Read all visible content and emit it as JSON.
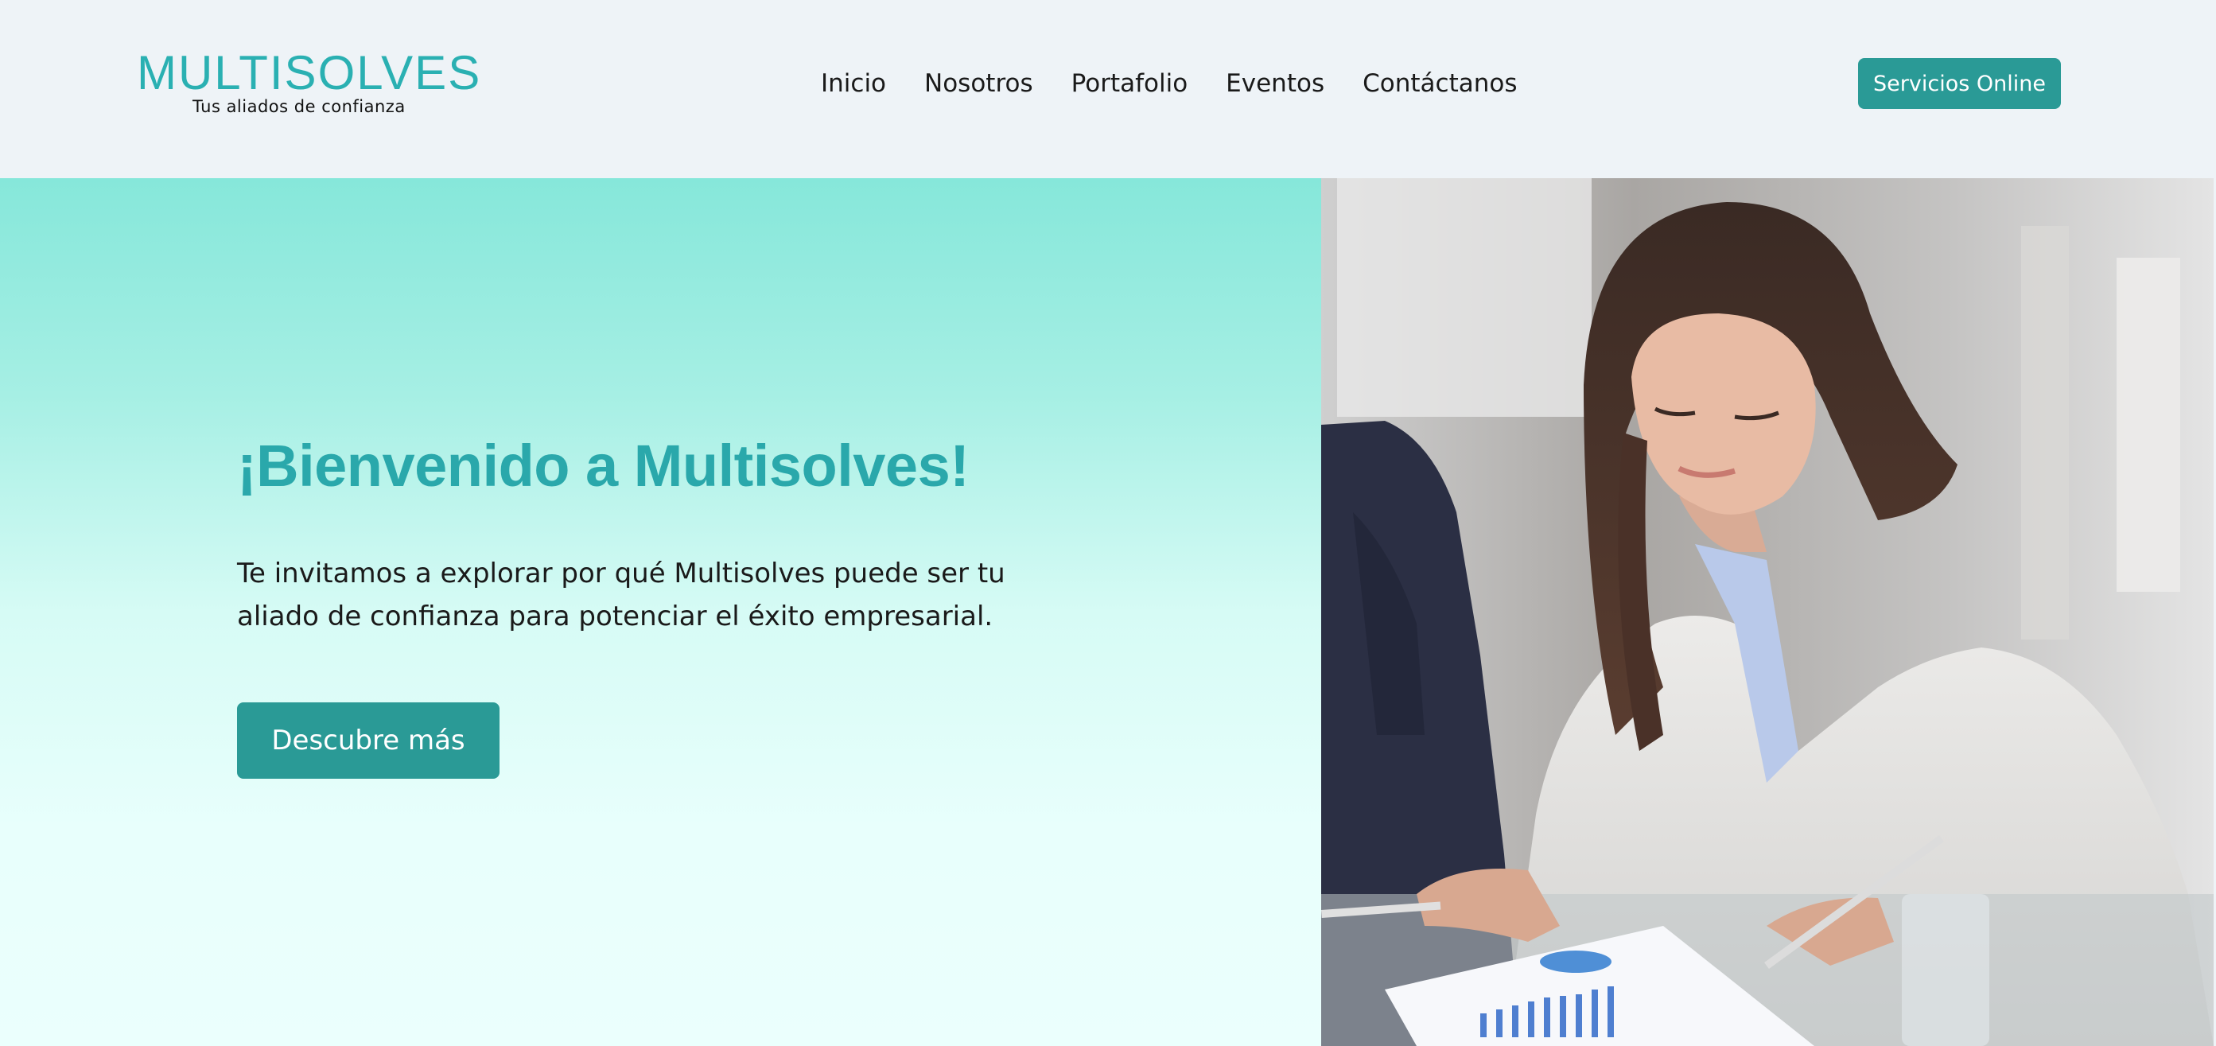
{
  "header": {
    "logo": {
      "title": "MULTISOLVES",
      "tagline": "Tus aliados de confianza"
    },
    "nav": [
      {
        "label": "Inicio"
      },
      {
        "label": "Nosotros"
      },
      {
        "label": "Portafolio"
      },
      {
        "label": "Eventos"
      },
      {
        "label": "Contáctanos"
      }
    ],
    "cta_label": "Servicios Online"
  },
  "hero": {
    "title": "¡Bienvenido a Multisolves!",
    "text": "Te invitamos a explorar por qué Multisolves puede ser tu aliado de confianza para potenciar el éxito empresarial.",
    "button_label": "Descubre más",
    "image_subject": "businesswoman-reviewing-report"
  },
  "colors": {
    "brand": "#2ab0b2",
    "button": "#2a9a96",
    "header_bg": "#eef3f7",
    "hero_gradient_top": "#86e7da",
    "hero_gradient_bottom": "#ebfffd"
  }
}
